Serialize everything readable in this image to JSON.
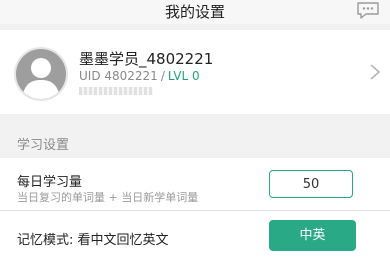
{
  "header": {
    "title": "我的设置",
    "chat_icon": "chat-bubble-icon"
  },
  "profile": {
    "avatar_icon": "default-avatar-icon",
    "username": "墨墨学员_4802221",
    "uid": "UID 4802221",
    "separator": "/",
    "level": "LVL 0",
    "chevron_icon": "chevron-right-icon"
  },
  "settings": {
    "section_title": "学习设置",
    "daily": {
      "label": "每日学习量",
      "description": "当日复习的单词量 + 当日新学单词量",
      "value": "50"
    },
    "memory": {
      "label": "记忆模式: 看中文回忆英文",
      "button_label": "中英"
    }
  },
  "colors": {
    "accent": "#2aa987",
    "level_text": "#1fa67a",
    "background": "#f2f2f2"
  }
}
